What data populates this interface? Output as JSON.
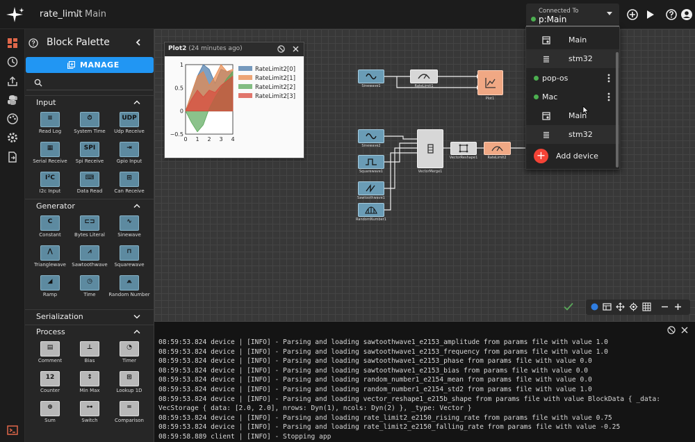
{
  "topbar": {
    "project": "rate_limit",
    "separator": "/",
    "page": "Main",
    "connection_label": "Connected To",
    "connection_value": "p:Main",
    "connection_status_color": "#4caf50"
  },
  "palette": {
    "title": "Block Palette",
    "manage_label": "MANAGE",
    "search_placeholder": "",
    "sections": [
      {
        "label": "Input",
        "blocks": [
          "Read Log",
          "System Time",
          "Udp Receive",
          "Serial Receive",
          "Spi Receive",
          "Gpio Input",
          "I2c Input",
          "Data Read",
          "Can Receive"
        ],
        "glyphs": [
          "≡",
          "⏱",
          "UDP",
          "▦",
          "SPI",
          "⇥",
          "I²C",
          "⌨",
          "⊞"
        ]
      },
      {
        "label": "Generator",
        "blocks": [
          "Constant",
          "Bytes Literal",
          "Sinewave",
          "Trianglewave",
          "Sawtoothwave",
          "Squarewave",
          "Ramp",
          "Time",
          "Random Number"
        ],
        "glyphs": [
          "C",
          "⊏⊐",
          "∿",
          "⋀",
          "⩘",
          "⊓",
          "◢",
          "◷",
          "⩕"
        ]
      },
      {
        "label": "Serialization",
        "blocks": []
      },
      {
        "label": "Process",
        "blocks": [
          "Comment",
          "Bias",
          "Timer",
          "Counter",
          "Min Max",
          "Lookup 1D",
          "Sum",
          "Switch",
          "Comparison"
        ],
        "glyphs": [
          "▤",
          "⊥",
          "◔",
          "12",
          "↕",
          "⊞",
          "⊕",
          "⊶",
          "="
        ]
      }
    ]
  },
  "plot_window": {
    "title": "Plot2",
    "subtitle": "(24 minutes ago)"
  },
  "chart_data": {
    "type": "area",
    "title": "",
    "xlabel": "",
    "ylabel": "",
    "xlim": [
      0,
      4
    ],
    "ylim": [
      -0.5,
      1
    ],
    "xticks": [
      "0",
      "1",
      "2",
      "3",
      "4"
    ],
    "yticks": [
      "1",
      "0.5",
      "0",
      "−0.5"
    ],
    "legend_position": "top-right",
    "series": [
      {
        "name": "RateLimit2[0]",
        "color": "#4878a8",
        "x": [
          0,
          0.5,
          1,
          1.5,
          2,
          2.5,
          3,
          3.5,
          4
        ],
        "y": [
          0,
          0.38,
          0.75,
          1.0,
          0.9,
          0.6,
          0.9,
          0.85,
          0.85
        ]
      },
      {
        "name": "RateLimit2[1]",
        "color": "#e8884a",
        "x": [
          0,
          0.5,
          1,
          1.5,
          2,
          2.5,
          3,
          3.5,
          4
        ],
        "y": [
          0,
          0.38,
          0.75,
          0.85,
          0.55,
          0.75,
          1.0,
          0.85,
          0.9
        ]
      },
      {
        "name": "RateLimit2[2]",
        "color": "#5aa85a",
        "x": [
          0,
          0.5,
          1,
          1.5,
          2,
          2.5,
          3,
          3.5,
          4
        ],
        "y": [
          0,
          -0.25,
          -0.45,
          -0.3,
          0.05,
          0.3,
          0.5,
          0.7,
          0.85
        ]
      },
      {
        "name": "RateLimit2[3]",
        "color": "#d84a3c",
        "x": [
          0,
          0.5,
          1,
          1.5,
          2,
          2.5,
          3,
          3.5,
          4
        ],
        "y": [
          0,
          0.25,
          0.45,
          0.3,
          0.45,
          0.4,
          0.55,
          0.65,
          0.75
        ]
      }
    ]
  },
  "diagram": {
    "nodes": [
      "Sinewave1",
      "RateLimit1",
      "Plot1",
      "Sinewave2",
      "Squarewave1",
      "Sawtoothwave1",
      "RandomNumber1",
      "VectorMerge1",
      "VectorReshape1",
      "RateLimit2"
    ]
  },
  "dropdown": {
    "items": [
      {
        "kind": "page",
        "label": "Main"
      },
      {
        "kind": "chip",
        "label": "stm32"
      },
      {
        "kind": "device",
        "label": "pop-os"
      },
      {
        "kind": "device",
        "label": "Mac"
      },
      {
        "kind": "page",
        "label": "Main"
      },
      {
        "kind": "chip",
        "label": "stm32"
      }
    ],
    "add_label": "Add device",
    "add_symbol": "+"
  },
  "console": {
    "lines": [
      "08:59:53.824 device | [INFO] - Parsing and loading sawtoothwave1_e2153_amplitude from params file with value 1.0",
      "08:59:53.824 device | [INFO] - Parsing and loading sawtoothwave1_e2153_frequency from params file with value 1.0",
      "08:59:53.824 device | [INFO] - Parsing and loading sawtoothwave1_e2153_phase from params file with value 0.0",
      "08:59:53.824 device | [INFO] - Parsing and loading sawtoothwave1_e2153_bias from params file with value 0.0",
      "08:59:53.824 device | [INFO] - Parsing and loading random_number1_e2154_mean from params file with value 0.0",
      "08:59:53.824 device | [INFO] - Parsing and loading random_number1_e2154_std2 from params file with value 1.0",
      "08:59:53.824 device | [INFO] - Parsing and loading vector_reshape1_e215b_shape from params file with value BlockData { _data:",
      "VecStorage { data: [2.0, 2.0], nrows: Dyn(1), ncols: Dyn(2) }, _type: Vector }",
      "08:59:53.824 device | [INFO] - Parsing and loading rate_limit2_e2150_rising_rate from params file with value 0.75",
      "08:59:53.824 device | [INFO] - Parsing and loading rate_limit2_e2150_falling_rate from params file with value -0.25",
      "08:59:58.889 client | [INFO] - Stopping app"
    ]
  },
  "colors": {
    "accent": "#2196f3",
    "add_device": "#f44336",
    "status_ok": "#4caf50",
    "highlight_block": "#f0a884"
  }
}
